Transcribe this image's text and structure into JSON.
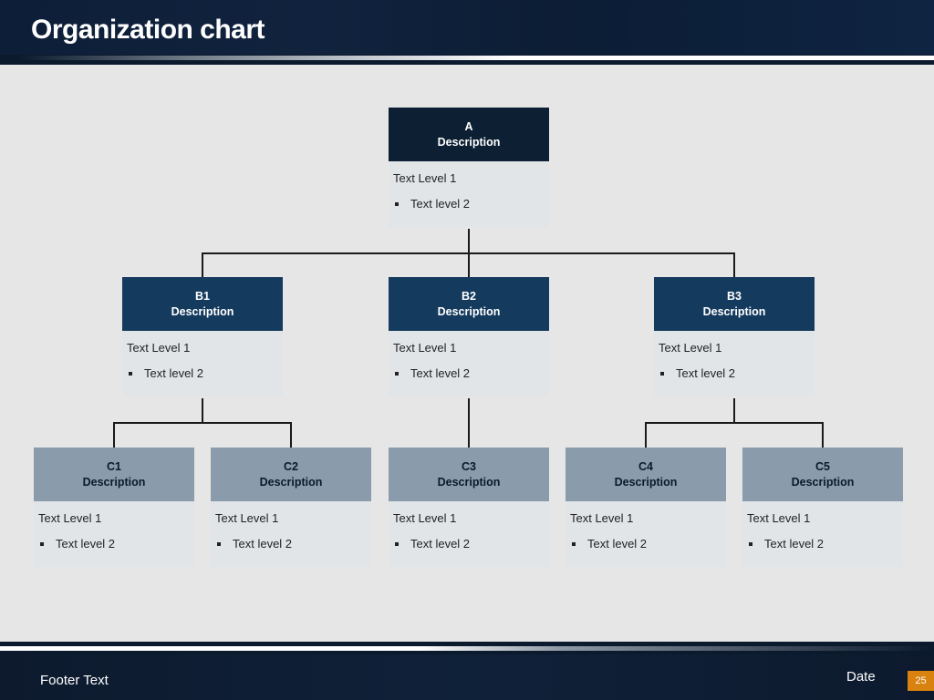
{
  "header": {
    "title": "Organization chart"
  },
  "footer": {
    "text": "Footer Text",
    "date": "Date",
    "page_number": "25"
  },
  "colors": {
    "level_a_head": "#0c1f33",
    "level_b_head": "#143a5e",
    "level_c_head": "#8a9bab",
    "page_badge": "#d9820f"
  },
  "org": {
    "a": {
      "id": "A",
      "desc": "Description",
      "level1": "Text Level 1",
      "level2": "Text level 2"
    },
    "b": [
      {
        "id": "B1",
        "desc": "Description",
        "level1": "Text Level 1",
        "level2": "Text level 2"
      },
      {
        "id": "B2",
        "desc": "Description",
        "level1": "Text Level 1",
        "level2": "Text level 2"
      },
      {
        "id": "B3",
        "desc": "Description",
        "level1": "Text Level 1",
        "level2": "Text level 2"
      }
    ],
    "c": [
      {
        "id": "C1",
        "parent": "B1",
        "desc": "Description",
        "level1": "Text Level 1",
        "level2": "Text level 2"
      },
      {
        "id": "C2",
        "parent": "B1",
        "desc": "Description",
        "level1": "Text Level 1",
        "level2": "Text level 2"
      },
      {
        "id": "C3",
        "parent": "B2",
        "desc": "Description",
        "level1": "Text Level 1",
        "level2": "Text level 2"
      },
      {
        "id": "C4",
        "parent": "B3",
        "desc": "Description",
        "level1": "Text Level 1",
        "level2": "Text level 2"
      },
      {
        "id": "C5",
        "parent": "B3",
        "desc": "Description",
        "level1": "Text Level 1",
        "level2": "Text level 2"
      }
    ]
  }
}
